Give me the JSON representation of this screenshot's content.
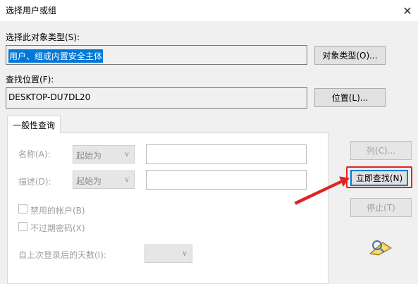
{
  "window": {
    "title": "选择用户或组",
    "close_glyph": "✕"
  },
  "object_type": {
    "label": "选择此对象类型(S):",
    "value": "用户、组或内置安全主体",
    "button": "对象类型(O)..."
  },
  "location": {
    "label": "查找位置(F):",
    "value": "DESKTOP-DU7DL20",
    "button": "位置(L)..."
  },
  "tab": {
    "label": "一般性查询"
  },
  "query": {
    "name_label": "名称(A):",
    "name_mode": "起始为",
    "desc_label": "描述(D):",
    "desc_mode": "起始为",
    "disabled_accounts": "禁用的帐户(B)",
    "non_expiring_pw": "不过期密码(X)",
    "days_label": "自上次登录后的天数(I):"
  },
  "buttons": {
    "columns": "列(C)...",
    "find_now": "立即查找(N)",
    "stop": "停止(T)"
  },
  "colors": {
    "highlight": "#e02424",
    "selection": "#0078d7"
  }
}
